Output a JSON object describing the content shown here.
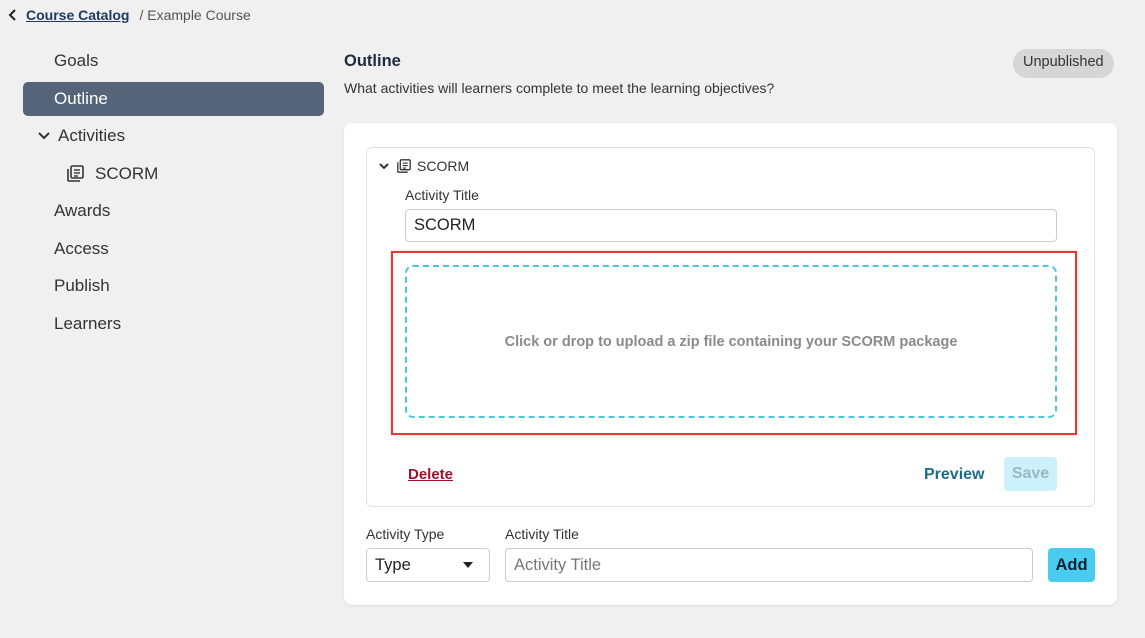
{
  "breadcrumb": {
    "back_link": "Course Catalog",
    "current": "/ Example Course"
  },
  "sidebar": {
    "items": [
      {
        "label": "Goals"
      },
      {
        "label": "Outline",
        "active": true
      },
      {
        "label": "Activities",
        "expanded": true
      },
      {
        "label": "SCORM"
      },
      {
        "label": "Awards"
      },
      {
        "label": "Access"
      },
      {
        "label": "Publish"
      },
      {
        "label": "Learners"
      }
    ]
  },
  "header": {
    "title": "Outline",
    "subtitle": "What activities will learners complete to meet the learning objectives?",
    "status_badge": "Unpublished"
  },
  "activity": {
    "name": "SCORM",
    "title_label": "Activity Title",
    "title_value": "SCORM",
    "dropzone_text": "Click or drop to upload a zip file containing your SCORM package",
    "delete_label": "Delete",
    "preview_label": "Preview",
    "save_label": "Save"
  },
  "new_activity": {
    "type_label": "Activity Type",
    "type_value": "Type",
    "title_label": "Activity Title",
    "title_placeholder": "Activity Title",
    "add_label": "Add"
  },
  "colors": {
    "sidebar_active_bg": "#566479",
    "dropzone_border": "#4cc6de",
    "highlight_border": "#e53935",
    "delete_link": "#a0102a",
    "preview_link": "#1a6d8a",
    "add_button_bg": "#48cdf0",
    "save_button_bg": "#cdf1fb"
  },
  "icons": {
    "back": "chevron-left-icon",
    "expand": "chevron-down-icon",
    "activity": "document-stack-icon",
    "select": "caret-down-icon"
  }
}
